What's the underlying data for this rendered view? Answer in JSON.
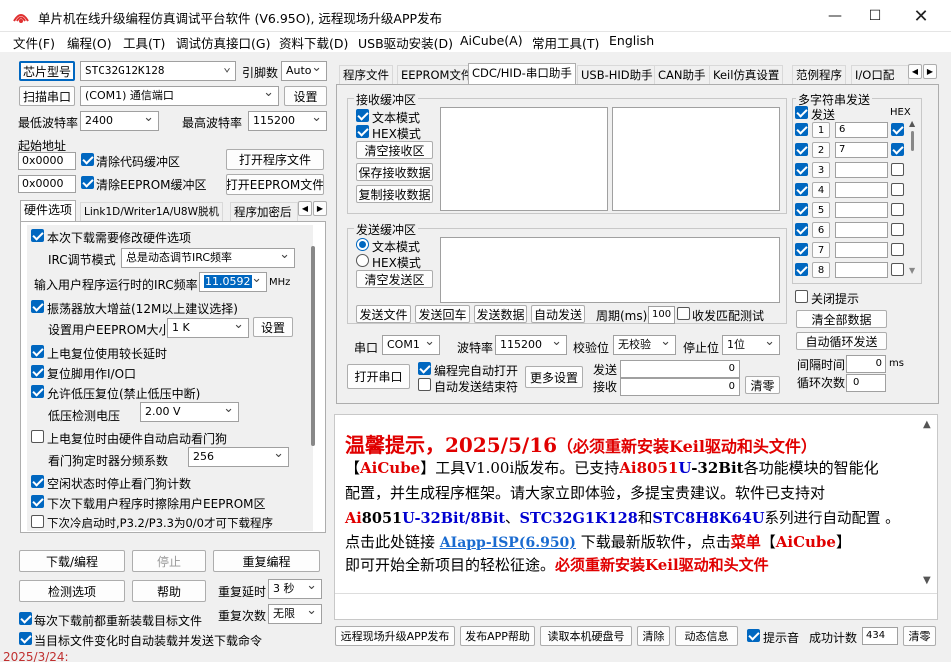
{
  "title": "单片机在线升级编程仿真调试平台软件 (V6.95O), 远程现场升级APP发布",
  "menu": [
    "文件(F)",
    "编程(O)",
    "工具(T)",
    "调试仿真接口(G)",
    "资料下载(D)",
    "USB驱动安装(D)",
    "AiCube(A)",
    "常用工具(T)",
    "English"
  ],
  "left": {
    "chip_btn": "芯片型号",
    "chip_val": "STC32G12K128",
    "pin_lbl": "引脚数",
    "pin_val": "Auto",
    "scan_btn": "扫描串口",
    "port_val": "(COM1) 通信端口",
    "settings_btn": "设置",
    "minbaud_lbl": "最低波特率",
    "minbaud_val": "2400",
    "maxbaud_lbl": "最高波特率",
    "maxbaud_val": "115200",
    "start_lbl": "起始地址",
    "addr1": "0x0000",
    "clear_code": "清除代码缓冲区",
    "open_prog": "打开程序文件",
    "addr2": "0x0000",
    "clear_eep": "清除EEPROM缓冲区",
    "open_eep": "打开EEPROM文件",
    "tabs": [
      "硬件选项",
      "Link1D/Writer1A/U8W脱机",
      "程序加密后"
    ],
    "hw": {
      "opt1": "本次下载需要修改硬件选项",
      "irc_lbl": "IRC调节模式",
      "irc_val": "总是动态调节IRC频率",
      "freq_lbl": "输入用户程序运行时的IRC频率",
      "freq_val": "11.0592",
      "freq_unit": "MHz",
      "opt2": "振荡器放大增益(12M以上建议选择)",
      "eep_lbl": "设置用户EEPROM大小",
      "eep_val": "1  K",
      "eep_btn": "设置",
      "opt3": "上电复位使用较长延时",
      "opt4": "复位脚用作I/O口",
      "opt5": "允许低压复位(禁止低压中断)",
      "lv_lbl": "低压检测电压",
      "lv_val": "2.00 V",
      "opt6": "上电复位时由硬件自动启动看门狗",
      "wdt_lbl": "看门狗定时器分频系数",
      "wdt_val": "256",
      "opt7": "空闲状态时停止看门狗计数",
      "opt8": "下次下载用户程序时擦除用户EEPROM区",
      "opt9": "下次冷启动时,P3.2/P3.3为0/0才可下载程序"
    },
    "download_btn": "下载/编程",
    "stop_btn": "停止",
    "redownload_btn": "重复编程",
    "check_btn": "检测选项",
    "help_btn": "帮助",
    "delay_lbl": "重复延时",
    "delay_val": "3 秒",
    "count_lbl": "重复次数",
    "count_val": "无限",
    "reload_lbl": "每次下载前都重新装载目标文件",
    "autoload_lbl": "当目标文件变化时自动装载并发送下载命令"
  },
  "right": {
    "tabs": [
      "程序文件",
      "EEPROM文件",
      "CDC/HID-串口助手",
      "USB-HID助手",
      "CAN助手",
      "Keil仿真设置",
      "范例程序",
      "I/O口配"
    ],
    "rx_group": "接收缓冲区",
    "rx_text": "文本模式",
    "rx_hex": "HEX模式",
    "rx_clear": "清空接收区",
    "rx_save": "保存接收数据",
    "rx_copy": "复制接收数据",
    "tx_group": "发送缓冲区",
    "tx_text": "文本模式",
    "tx_hex": "HEX模式",
    "tx_clear": "清空发送区",
    "send_file": "发送文件",
    "send_back": "发送回车",
    "send_data": "发送数据",
    "auto_send": "自动发送",
    "period_lbl": "周期(ms)",
    "period_val": "100",
    "match_lbl": "收发匹配测试",
    "multi_group": "多字符串发送",
    "send_lbl": "发送",
    "hex_lbl": "HEX",
    "multi_rows": [
      {
        "n": "1",
        "v": "6",
        "hex": true
      },
      {
        "n": "2",
        "v": "7",
        "hex": true
      },
      {
        "n": "3",
        "v": "",
        "hex": false
      },
      {
        "n": "4",
        "v": "",
        "hex": false
      },
      {
        "n": "5",
        "v": "",
        "hex": false
      },
      {
        "n": "6",
        "v": "",
        "hex": false
      },
      {
        "n": "7",
        "v": "",
        "hex": false
      },
      {
        "n": "8",
        "v": "",
        "hex": false
      }
    ],
    "close_tip": "关闭提示",
    "clear_all": "清全部数据",
    "auto_loop": "自动循环发送",
    "interval_lbl": "间隔时间",
    "interval_val": "0",
    "interval_unit": "ms",
    "loop_lbl": "循环次数",
    "loop_val": "0",
    "port_lbl": "串口",
    "port_val": "COM1",
    "baud_lbl": "波特率",
    "baud_val": "115200",
    "parity_lbl": "校验位",
    "parity_val": "无校验",
    "stop_lbl": "停止位",
    "stop_val": "1位",
    "open_port": "打开串口",
    "auto_open": "编程完自动打开",
    "auto_send_end": "自动发送结束符",
    "more_btn": "更多设置",
    "send_cnt_lbl": "发送",
    "send_cnt": "0",
    "recv_cnt_lbl": "接收",
    "recv_cnt": "0",
    "clear_cnt": "清零"
  },
  "notice": {
    "l1a": "温馨提示，2025/5/16",
    "l1b": "（必须重新安装Keil驱动和头文件）",
    "l2": [
      "【",
      "AiCube",
      "】工具V1.00i版发布。已支持",
      "Ai8051",
      "U",
      "-32Bit",
      "各功能模块的智能化"
    ],
    "l3": "配置，并生成程序框架。请大家立即体验，多提宝贵建议。软件已支持对",
    "l4": [
      "Ai",
      "8051",
      "U-32Bit/8Bit",
      "、",
      "STC32G1K128",
      "和",
      "STC8H8K64U",
      "系列进行自动配置 。"
    ],
    "l5": [
      "点击此处链接 ",
      "AIapp-ISP(6.950)",
      " 下载最新版软件，点击",
      "菜单",
      "【",
      "AiCube",
      "】"
    ],
    "l6": [
      "即可开始全新项目的轻松征途。",
      "必须重新安装Keil驱动和头文件"
    ]
  },
  "bottom": {
    "remote_btn": "远程现场升级APP发布",
    "publish_help": "发布APP帮助",
    "read_disk": "读取本机硬盘号",
    "clear_btn": "清除",
    "anim_btn": "动态信息",
    "beep_lbl": "提示音",
    "succ_lbl": "成功计数",
    "succ_val": "434",
    "zero_btn": "清零"
  },
  "edge_date": "2025/3/24:"
}
